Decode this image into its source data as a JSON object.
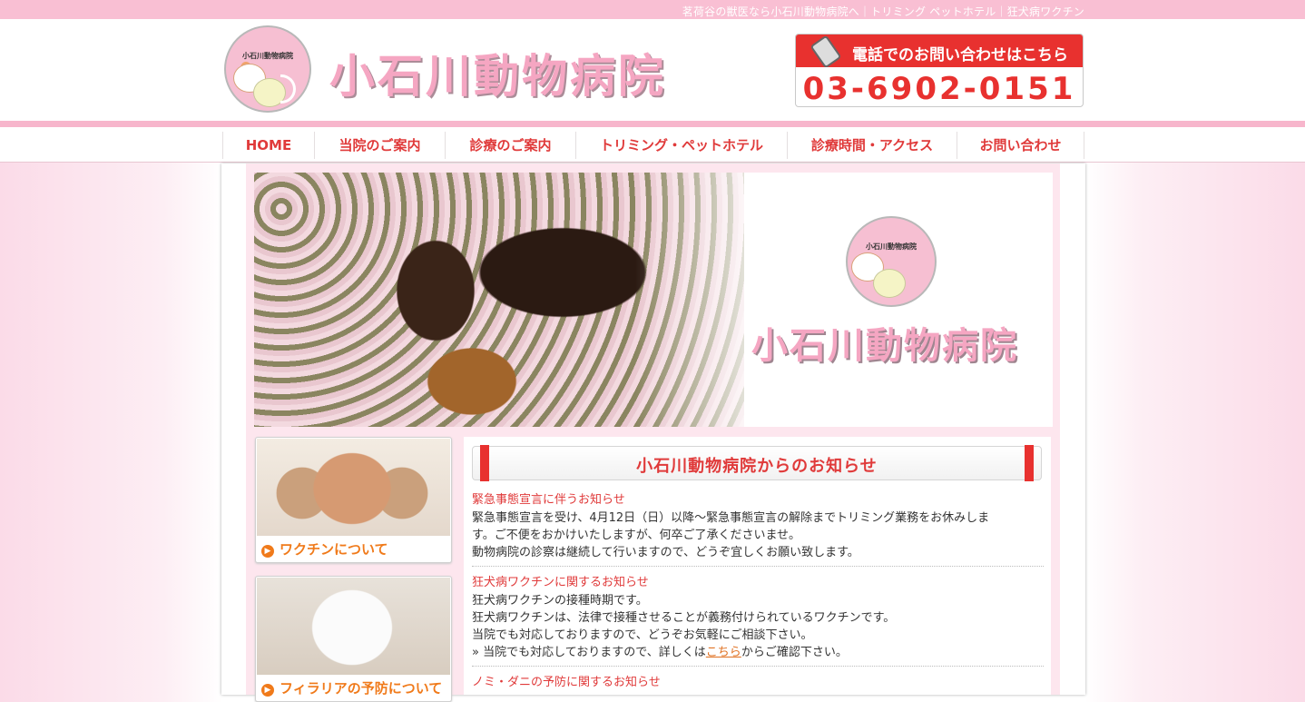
{
  "topbar": {
    "text": "茗荷谷の獣医なら小石川動物病院へ｜トリミング ペットホテル｜狂犬病ワクチン"
  },
  "header": {
    "logo_text": "小石川動物病院",
    "site_title": "小石川動物病院",
    "phone_label": "電話でのお問い合わせはこちら",
    "phone_number": "03-6902-0151"
  },
  "nav": {
    "items": [
      {
        "label": "HOME"
      },
      {
        "label": "当院のご案内"
      },
      {
        "label": "診療のご案内"
      },
      {
        "label": "トリミング・ペットホテル"
      },
      {
        "label": "診療時間・アクセス"
      },
      {
        "label": "お問い合わせ"
      }
    ]
  },
  "hero": {
    "logo_text": "小石川動物病院",
    "title": "小石川動物病院"
  },
  "side": {
    "banners": [
      {
        "label": "ワクチンについて"
      },
      {
        "label": "フィラリアの予防について"
      }
    ]
  },
  "news": {
    "heading": "小石川動物病院からのお知らせ",
    "items": [
      {
        "title": "緊急事態宣言に伴うお知らせ",
        "lines": [
          "緊急事態宣言を受け、4月12日（日）以降〜緊急事態宣言の解除までトリミング業務をお休みしま",
          "す。ご不便をおかけいたしますが、何卒ご了承くださいませ。",
          "動物病院の診察は継続して行いますので、どうぞ宜しくお願い致します。"
        ]
      },
      {
        "title": "狂犬病ワクチンに関するお知らせ",
        "lines": [
          "狂犬病ワクチンの接種時期です。",
          "狂犬病ワクチンは、法律で接種させることが義務付けられているワクチンです。",
          "当院でも対応しておりますので、どうぞお気軽にご相談下さい。"
        ],
        "link_prefix": "» 当院でも対応しておりますので、詳しくは",
        "link_text": "こちら",
        "link_suffix": "からご確認下さい。"
      },
      {
        "title": "ノミ・ダニの予防に関するお知らせ"
      }
    ]
  },
  "colors": {
    "accent_red": "#e8312f",
    "brand_pink": "#f5a6c2",
    "side_orange": "#f07a1a"
  }
}
